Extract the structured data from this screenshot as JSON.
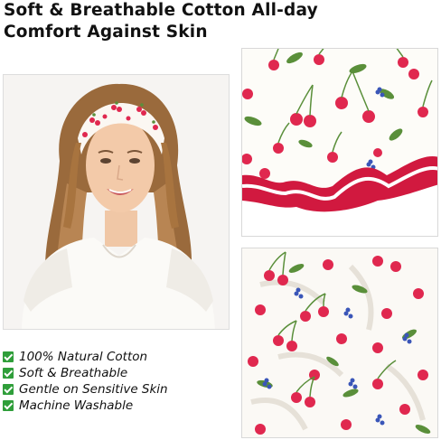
{
  "headline": {
    "line1": "Soft & Breathable Cotton All-day",
    "line2": "Comfort Against Skin"
  },
  "images": {
    "portrait": "woman-wearing-cherry-headband-photo",
    "fabric_top": "cherry-print-fabric-red-border-photo",
    "fabric_bottom": "cherry-print-fabric-closeup-photo"
  },
  "features": [
    "100% Natural Cotton",
    "Soft & Breathable",
    "Gentle on Sensitive Skin",
    "Machine Washable"
  ],
  "colors": {
    "check_green": "#2f9e3a",
    "cherry_red": "#e0284f",
    "border_crimson": "#d1193f",
    "leaf_green": "#5a8f3a",
    "flower_blue": "#3a56b8"
  }
}
